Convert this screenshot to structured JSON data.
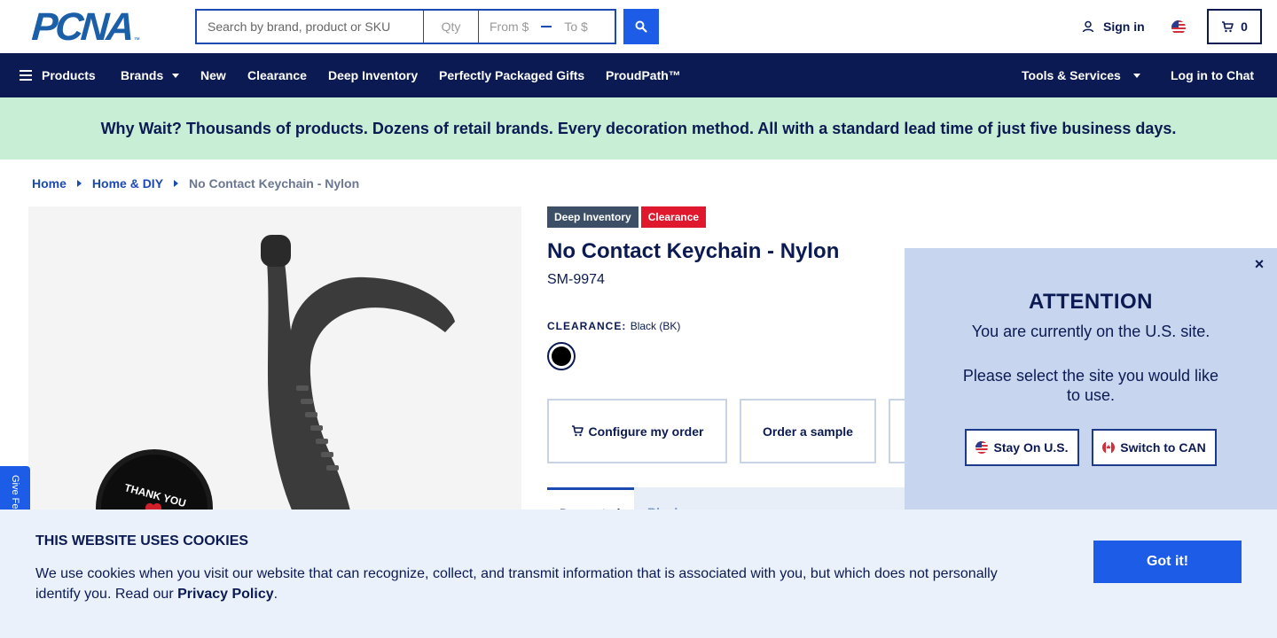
{
  "header": {
    "logo_text": "PCNA",
    "logo_tm": "™",
    "search_placeholder": "Search by brand, product or SKU",
    "qty_placeholder": "Qty",
    "from_placeholder": "From $",
    "to_placeholder": "To $",
    "sign_in": "Sign in",
    "cart_count": "0"
  },
  "nav": {
    "products": "Products",
    "brands": "Brands",
    "new": "New",
    "clearance": "Clearance",
    "deep_inventory": "Deep Inventory",
    "gifts": "Perfectly Packaged Gifts",
    "proudpath": "ProudPath™",
    "tools": "Tools & Services",
    "chat": "Log in to Chat"
  },
  "banner": {
    "text": "Why Wait? Thousands of products. Dozens of retail brands. Every decoration method. All with a standard lead time of just five business days."
  },
  "breadcrumb": {
    "home": "Home",
    "category": "Home & DIY",
    "current": "No Contact Keychain - Nylon"
  },
  "feedback": {
    "label": "Give Feedback"
  },
  "product": {
    "badges": [
      "Deep Inventory",
      "Clearance"
    ],
    "title": "No Contact Keychain - Nylon",
    "sku": "SM-9974",
    "clearance_label": "CLEARANCE:",
    "color_name": "Black (BK)",
    "swatch_color": "#000000",
    "actions": {
      "configure": "Configure my order",
      "sample": "Order a sample"
    },
    "tabs": {
      "active": "Decorated",
      "other": "Blank"
    },
    "sticker_text": "THANK YOU"
  },
  "modal": {
    "title": "ATTENTION",
    "line1": "You are currently on the U.S. site.",
    "line2": "Please select the site you would like to use.",
    "stay": "Stay On U.S.",
    "switch": "Switch to CAN",
    "close": "×"
  },
  "cookie": {
    "title": "THIS WEBSITE USES COOKIES",
    "text": "We use cookies when you visit our website that can recognize, collect, and transmit information that is associated with you, but which does not personally identify you. Read our ",
    "link": "Privacy Policy",
    "end": ".",
    "button": "Got it!"
  },
  "colors": {
    "navy": "#0b1a52",
    "blue": "#1d5ce6",
    "banner_green": "#c8eed5",
    "clearance_red": "#e0182d",
    "modal_bg": "#c7d6ee",
    "cookie_bg": "#eaf1fb"
  }
}
